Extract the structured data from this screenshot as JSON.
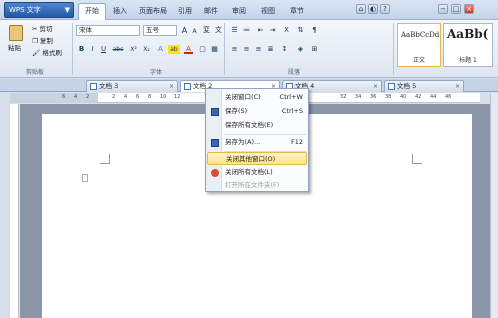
{
  "app": {
    "button_label": "WPS 文字",
    "caret": "▼"
  },
  "menubar": [
    "开始",
    "插入",
    "页面布局",
    "引用",
    "邮件",
    "审阅",
    "视图",
    "章节"
  ],
  "window_controls": [
    "−",
    "□",
    "×"
  ],
  "ribbon": {
    "clipboard": {
      "paste": "粘贴",
      "cut": "剪切",
      "copy": "复制",
      "format_painter": "格式刷",
      "group_label": "剪贴板"
    },
    "font": {
      "family": "宋体",
      "size": "五号",
      "grow": "A",
      "shrink": "A",
      "clear": "変",
      "pinyin": "文",
      "bold": "B",
      "italic": "I",
      "underline": "U",
      "strike": "abc",
      "sup": "X²",
      "sub": "X₂",
      "effects": "A",
      "highlight": "ab",
      "color": "A",
      "group_label": "字体"
    },
    "paragraph": {
      "group_label": "段落"
    },
    "styles": [
      {
        "sample": "AaBbCcDd",
        "name": "正文"
      },
      {
        "sample": "AaBb(",
        "name": "标题 1"
      }
    ]
  },
  "tabs": [
    {
      "label": "文档 3",
      "active": false
    },
    {
      "label": "文档 2",
      "active": true
    },
    {
      "label": "文档 4",
      "active": false
    },
    {
      "label": "文档 5",
      "active": false
    }
  ],
  "ruler_numbers": [
    "6",
    "4",
    "2",
    "2",
    "4",
    "6",
    "8",
    "10",
    "12",
    "32",
    "34",
    "36",
    "38",
    "40",
    "42",
    "44",
    "46"
  ],
  "context_menu": [
    {
      "label": "关闭窗口(C)",
      "shortcut": "Ctrl+W",
      "icon": "close-window-icon",
      "state": "normal"
    },
    {
      "label": "保存(S)",
      "shortcut": "Ctrl+S",
      "icon": "save-icon",
      "state": "normal"
    },
    {
      "label": "保存所有文档(E)",
      "shortcut": "",
      "icon": "",
      "state": "normal"
    },
    {
      "label": "另存为(A)...",
      "shortcut": "F12",
      "icon": "save-as-icon",
      "state": "normal"
    },
    {
      "label": "关闭其他窗口(O)",
      "shortcut": "",
      "icon": "",
      "state": "highlighted"
    },
    {
      "label": "关闭所有文档(L)",
      "shortcut": "",
      "icon": "close-all-icon",
      "state": "normal"
    },
    {
      "label": "打开所在文件夹(F)",
      "shortcut": "",
      "icon": "",
      "state": "disabled"
    }
  ],
  "colors": {
    "accent": "#2458a5",
    "highlight": "#ffe28a",
    "ribbon": "#dde6f1"
  }
}
